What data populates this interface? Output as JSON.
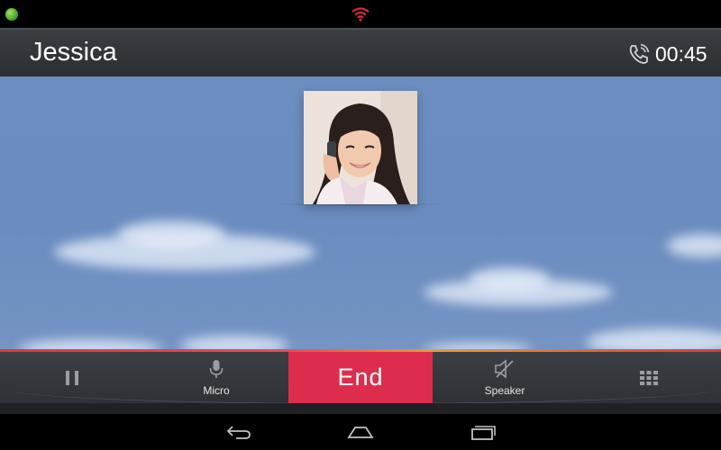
{
  "status_bar": {
    "indicator_icon": "status-dot-icon",
    "wifi_icon": "wifi-icon",
    "indicator_color": "#3f9e1d",
    "wifi_color": "#d8293d"
  },
  "call_header": {
    "caller_name": "Jessica",
    "phone_icon": "phone-call-icon",
    "duration": "00:45"
  },
  "caller_photo": {
    "icon": "contact-photo"
  },
  "controls": {
    "hold": {
      "icon": "pause-icon",
      "label": ""
    },
    "micro": {
      "icon": "microphone-icon",
      "label": "Micro"
    },
    "end": {
      "label": "End",
      "color": "#dc2d4d"
    },
    "speaker": {
      "icon": "speaker-muted-icon",
      "label": "Speaker"
    },
    "keypad": {
      "icon": "dialpad-icon",
      "label": ""
    }
  },
  "nav_bar": {
    "back_icon": "back-icon",
    "home_icon": "home-icon",
    "recents_icon": "recent-apps-icon"
  }
}
